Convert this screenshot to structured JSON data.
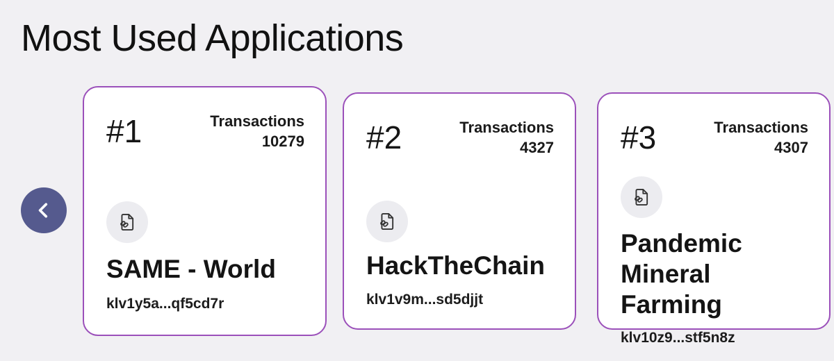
{
  "header": {
    "title": "Most Used Applications"
  },
  "navigation": {
    "prev_icon": "chevron-left-icon",
    "accent_color": "#555a8e"
  },
  "cards": [
    {
      "rank": "#1",
      "transactions_label": "Transactions",
      "transactions": "10279",
      "name": "SAME - World",
      "address": "klv1y5a...qf5cd7r",
      "icon": "file-link-icon"
    },
    {
      "rank": "#2",
      "transactions_label": "Transactions",
      "transactions": "4327",
      "name": "HackTheChain",
      "address": "klv1v9m...sd5djjt",
      "icon": "file-link-icon"
    },
    {
      "rank": "#3",
      "transactions_label": "Transactions",
      "transactions": "4307",
      "name": "Pandemic Mineral Farming",
      "address": "klv10z9...stf5n8z",
      "icon": "file-link-icon"
    }
  ],
  "colors": {
    "card_border": "#9b50ba",
    "background": "#f1f0f3"
  }
}
